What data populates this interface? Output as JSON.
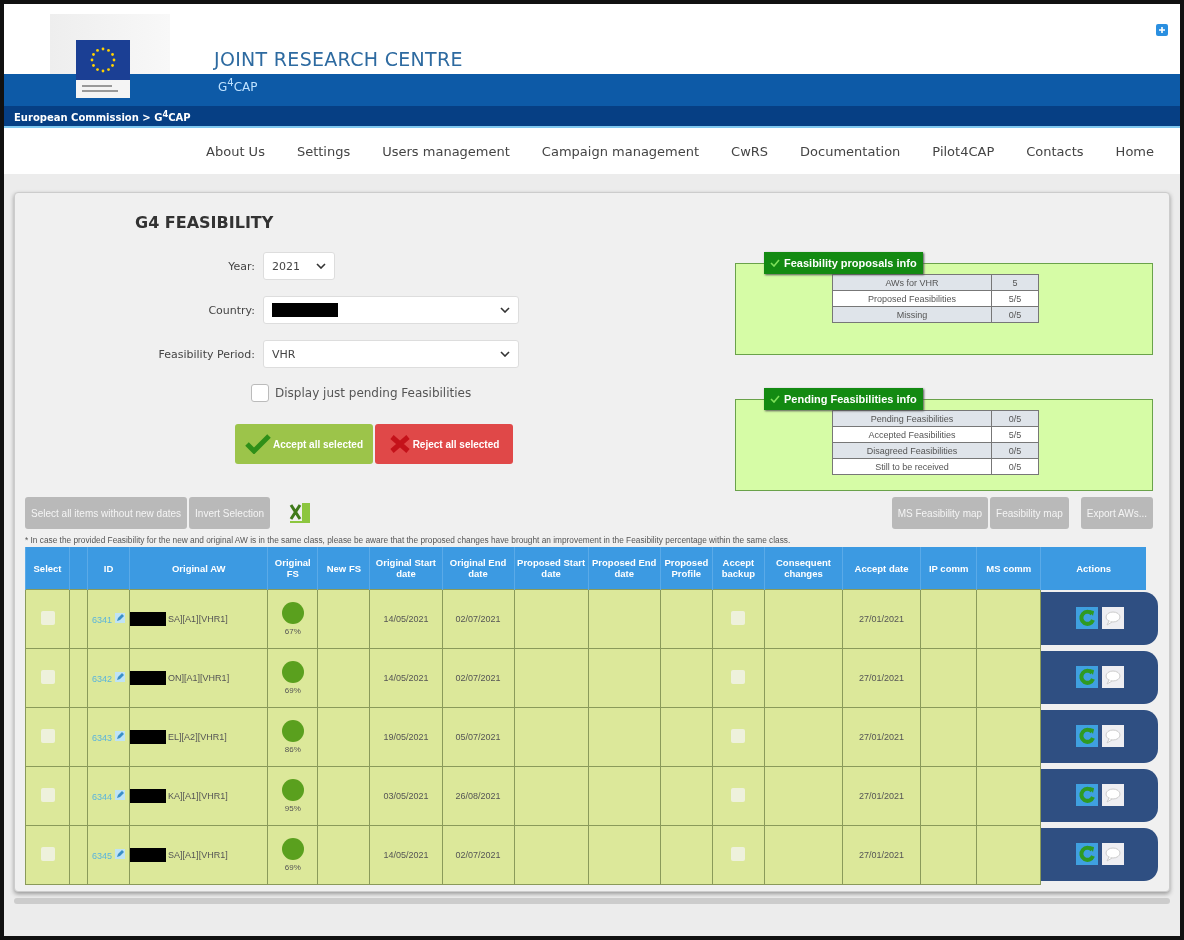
{
  "header": {
    "org": "JOINT RESEARCH CENTRE",
    "app": "G$^{4}$CAP",
    "breadcrumb": "European Commission > G$^{4}$CAP"
  },
  "nav": [
    "About Us",
    "Settings",
    "Users management",
    "Campaign management",
    "CwRS",
    "Documentation",
    "Pilot4CAP",
    "Contacts",
    "Home"
  ],
  "page_title": "G4 FEASIBILITY",
  "filters": [
    {
      "label": "Year:",
      "value": "2021",
      "kind": "short"
    },
    {
      "label": "Country:",
      "kind": "redacted"
    },
    {
      "label": "Feasibility Period:",
      "value": "VHR",
      "kind": "wide"
    }
  ],
  "pending_only": {
    "label": "Display just pending Feasibilities",
    "checked": false
  },
  "actions": [
    {
      "label": "Accept all selected",
      "kind": "accept"
    },
    {
      "label": "Reject all selected",
      "kind": "reject"
    }
  ],
  "info_panels": [
    {
      "title": "Feasibility proposals info",
      "rows": [
        [
          "AWs for VHR",
          "5"
        ],
        [
          "Proposed Feasibilities",
          "5/5"
        ],
        [
          "Missing",
          "0/5"
        ]
      ]
    },
    {
      "title": "Pending Feasibilities info",
      "rows": [
        [
          "Pending Feasibilities",
          "0/5"
        ],
        [
          "Accepted Feasibilities",
          "5/5"
        ],
        [
          "Disagreed Feasibilities",
          "0/5"
        ],
        [
          "Still to be received",
          "0/5"
        ]
      ]
    }
  ],
  "toolbar_left": [
    "Select all items without new dates",
    "Invert Selection"
  ],
  "toolbar_right": [
    "MS Feasibility map",
    "Feasibility map",
    "Export AWs..."
  ],
  "footnote": "* In case the provided Feasibility for the new and original AW is in the same class, please be aware that the proposed changes have brought an improvement in the Feasibility percentage within the same class.",
  "table": {
    "columns": [
      "Select",
      "",
      "ID",
      "Original AW",
      "Original FS",
      "New FS",
      "Original Start date",
      "Original End date",
      "Proposed Start date",
      "Proposed End date",
      "Proposed Profile",
      "Accept backup",
      "Consequent changes",
      "Accept date",
      "IP comm",
      "MS comm",
      "Actions"
    ],
    "rows": [
      {
        "selected": false,
        "id": "6341",
        "aw": "SA][A1][VHR1]",
        "fs": "67%",
        "color": "#5aa01e",
        "start": "14/05/2021",
        "end": "02/07/2021",
        "accept_backup": false,
        "accept_date": "27/01/2021"
      },
      {
        "selected": false,
        "id": "6342",
        "aw": "ON][A1][VHR1]",
        "fs": "69%",
        "color": "#5aa01e",
        "start": "14/05/2021",
        "end": "02/07/2021",
        "accept_backup": false,
        "accept_date": "27/01/2021"
      },
      {
        "selected": false,
        "id": "6343",
        "aw": "EL][A2][VHR1]",
        "fs": "86%",
        "color": "#5aa01e",
        "start": "19/05/2021",
        "end": "05/07/2021",
        "accept_backup": false,
        "accept_date": "27/01/2021"
      },
      {
        "selected": false,
        "id": "6344",
        "aw": "KA][A1][VHR1]",
        "fs": "95%",
        "color": "#5aa01e",
        "start": "03/05/2021",
        "end": "26/08/2021",
        "accept_backup": false,
        "accept_date": "27/01/2021"
      },
      {
        "selected": false,
        "id": "6345",
        "aw": "SA][A1][VHR1]",
        "fs": "69%",
        "color": "#5aa01e",
        "start": "14/05/2021",
        "end": "02/07/2021",
        "accept_backup": false,
        "accept_date": "27/01/2021"
      }
    ]
  }
}
